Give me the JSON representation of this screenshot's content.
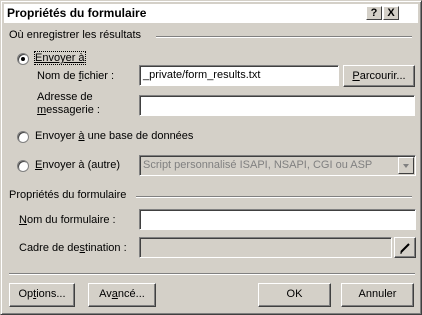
{
  "window": {
    "title": "Propriétés du formulaire",
    "help_label": "?",
    "close_label": "X"
  },
  "save_section": {
    "heading": "Où enregistrer les résultats",
    "send_to": {
      "label": "Envoyer à",
      "selected": true,
      "file_name_label": "Nom de fichier :",
      "file_name_value": "_private/form_results.txt",
      "browse_label": "Parcourir...",
      "email_label_1": "Adresse de",
      "email_label_2": "messagerie :",
      "email_value": ""
    },
    "send_db": {
      "label": "Envoyer à une base de données",
      "selected": false
    },
    "send_other": {
      "label": "Envoyer à (autre)",
      "selected": false,
      "select_value": "Script personnalisé ISAPI, NSAPI, CGI ou ASP"
    }
  },
  "form_props": {
    "heading": "Propriétés du formulaire",
    "name_label": "Nom du formulaire :",
    "name_value": "",
    "target_label": "Cadre de destination :",
    "target_value": ""
  },
  "footer": {
    "options_label": "Options...",
    "advanced_label": "Avancé...",
    "ok_label": "OK",
    "cancel_label": "Annuler"
  }
}
